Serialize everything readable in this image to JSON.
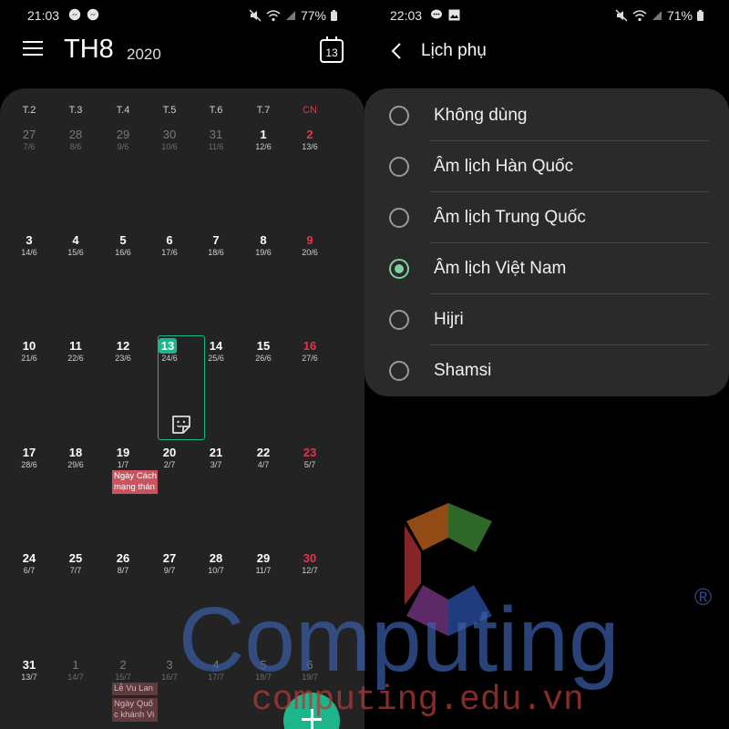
{
  "left": {
    "status": {
      "time": "21:03",
      "battery": "77%",
      "icons_left": [
        "messenger-icon",
        "messenger-icon"
      ],
      "icons_right": [
        "mute-icon",
        "wifi-icon",
        "signal-icon",
        "battery-icon"
      ]
    },
    "header": {
      "month": "TH8",
      "year": "2020",
      "today_number": "13"
    },
    "weekdays": [
      "T.2",
      "T.3",
      "T.4",
      "T.5",
      "T.6",
      "T.7",
      "CN"
    ],
    "weeks": [
      [
        {
          "d": "27",
          "l": "7/6",
          "m": true
        },
        {
          "d": "28",
          "l": "8/6",
          "m": true
        },
        {
          "d": "29",
          "l": "9/6",
          "m": true
        },
        {
          "d": "30",
          "l": "10/6",
          "m": true
        },
        {
          "d": "31",
          "l": "11/6",
          "m": true
        },
        {
          "d": "1",
          "l": "12/6",
          "m": false
        },
        {
          "d": "2",
          "l": "13/6",
          "m": false
        }
      ],
      [
        {
          "d": "3",
          "l": "14/6",
          "m": false
        },
        {
          "d": "4",
          "l": "15/6",
          "m": false
        },
        {
          "d": "5",
          "l": "16/6",
          "m": false
        },
        {
          "d": "6",
          "l": "17/6",
          "m": false
        },
        {
          "d": "7",
          "l": "18/6",
          "m": false
        },
        {
          "d": "8",
          "l": "19/6",
          "m": false
        },
        {
          "d": "9",
          "l": "20/6",
          "m": false
        }
      ],
      [
        {
          "d": "10",
          "l": "21/6",
          "m": false
        },
        {
          "d": "11",
          "l": "22/6",
          "m": false
        },
        {
          "d": "12",
          "l": "23/6",
          "m": false
        },
        {
          "d": "13",
          "l": "24/6",
          "m": false
        },
        {
          "d": "14",
          "l": "25/6",
          "m": false
        },
        {
          "d": "15",
          "l": "26/6",
          "m": false
        },
        {
          "d": "16",
          "l": "27/6",
          "m": false
        }
      ],
      [
        {
          "d": "17",
          "l": "28/6",
          "m": false
        },
        {
          "d": "18",
          "l": "29/6",
          "m": false
        },
        {
          "d": "19",
          "l": "1/7",
          "m": false
        },
        {
          "d": "20",
          "l": "2/7",
          "m": false
        },
        {
          "d": "21",
          "l": "3/7",
          "m": false
        },
        {
          "d": "22",
          "l": "4/7",
          "m": false
        },
        {
          "d": "23",
          "l": "5/7",
          "m": false
        }
      ],
      [
        {
          "d": "24",
          "l": "6/7",
          "m": false
        },
        {
          "d": "25",
          "l": "7/7",
          "m": false
        },
        {
          "d": "26",
          "l": "8/7",
          "m": false
        },
        {
          "d": "27",
          "l": "9/7",
          "m": false
        },
        {
          "d": "28",
          "l": "10/7",
          "m": false
        },
        {
          "d": "29",
          "l": "11/7",
          "m": false
        },
        {
          "d": "30",
          "l": "12/7",
          "m": false
        }
      ],
      [
        {
          "d": "31",
          "l": "13/7",
          "m": false
        },
        {
          "d": "1",
          "l": "14/7",
          "m": true
        },
        {
          "d": "2",
          "l": "15/7",
          "m": true
        },
        {
          "d": "3",
          "l": "16/7",
          "m": true
        },
        {
          "d": "4",
          "l": "17/7",
          "m": true
        },
        {
          "d": "5",
          "l": "18/7",
          "m": true
        },
        {
          "d": "6",
          "l": "19/7",
          "m": true
        }
      ]
    ],
    "events": {
      "cach_mang": [
        "Ngày Cách",
        "mạng thán"
      ],
      "vu_lan": "Lễ Vu Lan",
      "quoc_khanh": [
        "Ngày Quố",
        "c khánh Vi"
      ]
    },
    "colors": {
      "accent": "#1db58c",
      "sunday": "#e3344a",
      "event": "#c9545f"
    }
  },
  "right": {
    "status": {
      "time": "22:03",
      "battery": "71%",
      "icons_left": [
        "chat-icon",
        "image-icon"
      ],
      "icons_right": [
        "mute-icon",
        "wifi-icon",
        "signal-icon",
        "battery-icon"
      ]
    },
    "title": "Lịch phụ",
    "options": [
      {
        "label": "Không dùng",
        "selected": false
      },
      {
        "label": "Âm lịch Hàn Quốc",
        "selected": false
      },
      {
        "label": "Âm lịch Trung Quốc",
        "selected": false
      },
      {
        "label": "Âm lịch Việt Nam",
        "selected": true
      },
      {
        "label": "Hijri",
        "selected": false
      },
      {
        "label": "Shamsi",
        "selected": false
      }
    ],
    "colors": {
      "radio_selected": "#7ed09c"
    }
  },
  "watermark": {
    "brand": "Computing",
    "registered": "®",
    "site": "computing.edu.vn"
  }
}
